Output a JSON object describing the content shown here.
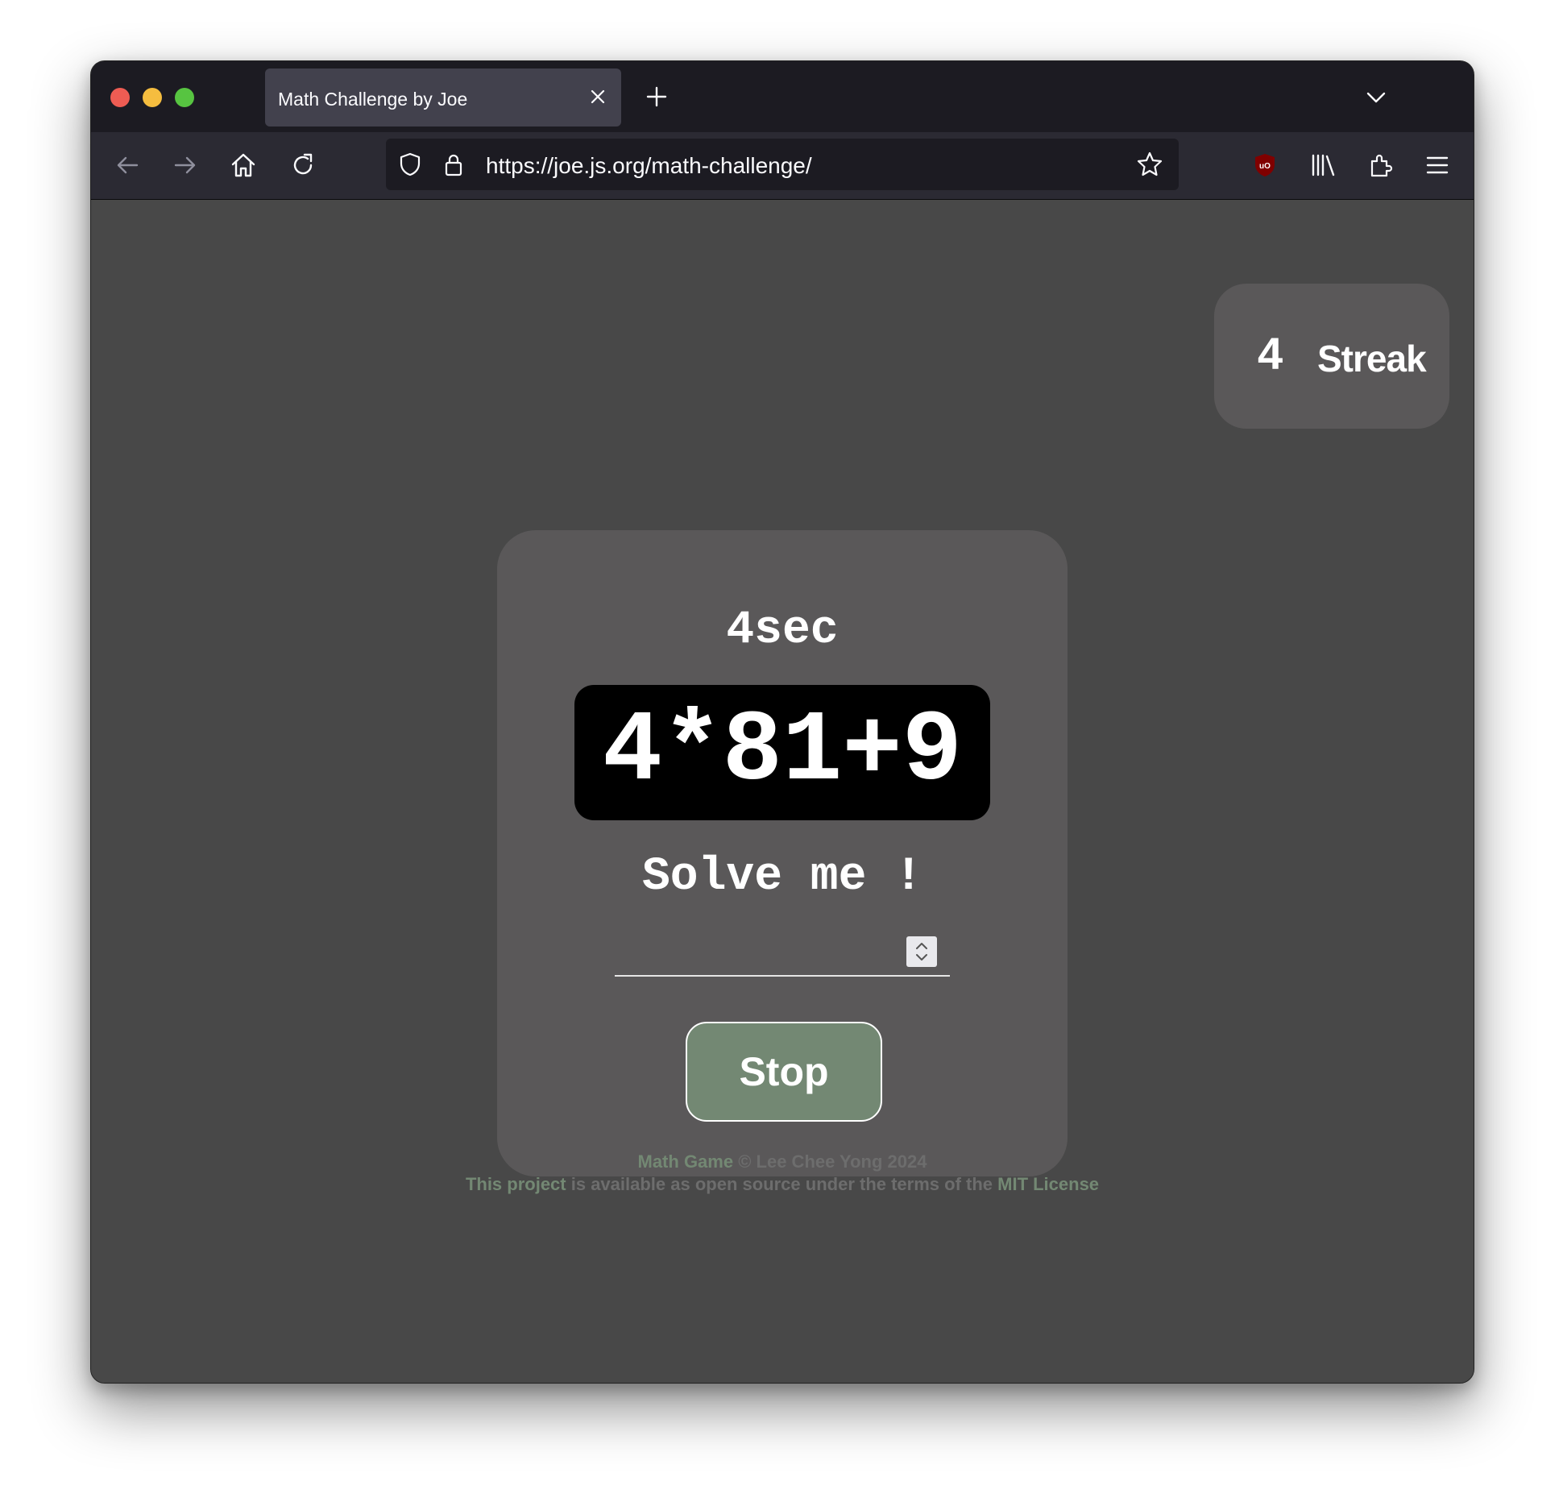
{
  "browser": {
    "tab_title": "Math Challenge by Joe",
    "url": "https://joe.js.org/math-challenge/"
  },
  "streak": {
    "count": "4",
    "label": "Streak"
  },
  "game": {
    "timer": "4sec",
    "problem": "4*81+9",
    "prompt": "Solve me !",
    "answer_value": "",
    "stop_label": "Stop"
  },
  "footer": {
    "game_link": "Math Game",
    "copyright": " © Lee Chee Yong 2024",
    "project_link": "This project",
    "license_text": " is available as open source under the terms of the ",
    "license_link": "MIT License"
  },
  "colors": {
    "page_bg": "#484848",
    "card_bg": "#5a5859",
    "accent_green": "#738873",
    "problem_bg": "#000000"
  }
}
